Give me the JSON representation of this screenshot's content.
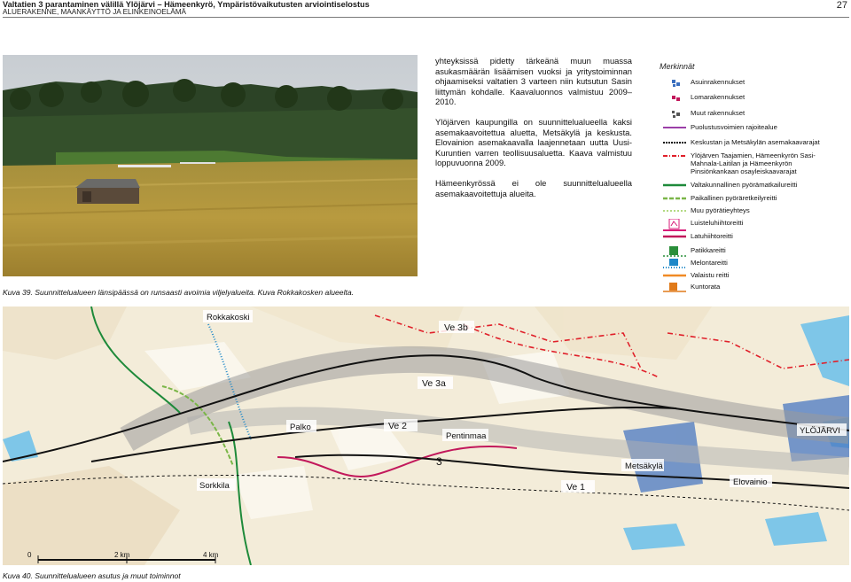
{
  "header": {
    "title": "Valtatien 3 parantaminen välillä Ylöjärvi – Hämeenkyrö, Ympäristövaikutusten arviointiselostus",
    "subtitle": "ALUERAKENNE, MAANKÄYTTÖ JA ELINKEINOELÄMÄ",
    "page_number": "27"
  },
  "photo_caption": "Kuva 39. Suunnittelualueen länsipäässä on runsaasti avoimia viljelyalueita. Kuva Rokkakosken alueelta.",
  "body_text": {
    "p1": "yhteyksissä pidetty tärkeänä muun muassa asukasmäärän lisäämisen vuoksi ja yritystoiminnan ohjaamiseksi valtatien 3 varteen niin kutsutun Sasin liittymän kohdalle. Kaavaluonnos valmistuu 2009–2010.",
    "p2": "Ylöjärven kaupungilla on suunnittelualueella kaksi asemakaavoitettua aluetta, Metsäkylä ja keskusta. Elovainion asemakaavalla laajennetaan uutta Uusi-Kuruntien varren teollisuusaluetta. Kaava valmistuu loppuvuonna 2009.",
    "p3": "Hämeenkyrössä ei ole suunnittelualueella asemakaavoitettuja alueita."
  },
  "legend": {
    "title": "Merkinnät",
    "items": [
      {
        "label": "Asuinrakennukset",
        "icon": "residential-buildings-icon",
        "color": "#3a6fbf"
      },
      {
        "label": "Lomarakennukset",
        "icon": "holiday-buildings-icon",
        "color": "#c2185b"
      },
      {
        "label": "Muut rakennukset",
        "icon": "other-buildings-icon",
        "color": "#555555"
      },
      {
        "label": "Puolustusvoimien rajoitealue",
        "icon": "restriction-line-icon",
        "color": "#9b3fa8"
      },
      {
        "label": "Keskustan ja Metsäkylän asemakaavarajat",
        "icon": "zoning-boundary-icon",
        "color": "#111111"
      },
      {
        "label": "Ylöjärven Taajamien, Hämeenkyrön Sasi-Mahnala-Laitilan ja Hämeenkyrön Pinsiönkankaan osayleiskaavarajat",
        "icon": "master-plan-boundary-icon",
        "color": "#e0202a"
      },
      {
        "label": "Valtakunnallinen pyörämatkailureitti",
        "icon": "national-cycle-route-icon",
        "color": "#1e8a3a"
      },
      {
        "label": "Paikallinen pyöräretkeilyreitti",
        "icon": "local-cycle-route-icon",
        "color": "#7ab648"
      },
      {
        "label": "Muu pyörätieyhteys",
        "icon": "other-cycle-path-icon",
        "color": "#9acd5a"
      },
      {
        "label": "Luisteluhiihtoreitti",
        "icon": "skate-ski-route-icon",
        "color": "#d81b78"
      },
      {
        "label": "Latuhiihtoreitti",
        "icon": "ski-trail-icon",
        "color": "#c2185b"
      },
      {
        "label": "Patikkareitti",
        "icon": "hiking-trail-icon",
        "color": "#2a8f3a"
      },
      {
        "label": "Melontareitti",
        "icon": "canoe-route-icon",
        "color": "#1e88c8"
      },
      {
        "label": "Valaistu reitti",
        "icon": "lit-trail-icon",
        "color": "#f08a24"
      },
      {
        "label": "Kuntorata",
        "icon": "fitness-track-icon",
        "color": "#e07a1a"
      }
    ]
  },
  "map": {
    "labels": {
      "rokkakoski": "Rokkakoski",
      "ve3b": "Ve 3b",
      "ve3a": "Ve 3a",
      "palko": "Palko",
      "ve2": "Ve 2",
      "pentinmaa": "Pentinmaa",
      "ve3": "3",
      "metsakyla": "Metsäkylä",
      "ylojarvi": "YLÖJÄRVI",
      "sorkkila": "Sorkkila",
      "ve1": "Ve 1",
      "elovainio": "Elovainio"
    },
    "scale": {
      "zero": "0",
      "two": "2 km",
      "four": "4 km"
    }
  },
  "map_caption": "Kuva 40. Suunnittelualueen asutus ja muut toiminnot"
}
